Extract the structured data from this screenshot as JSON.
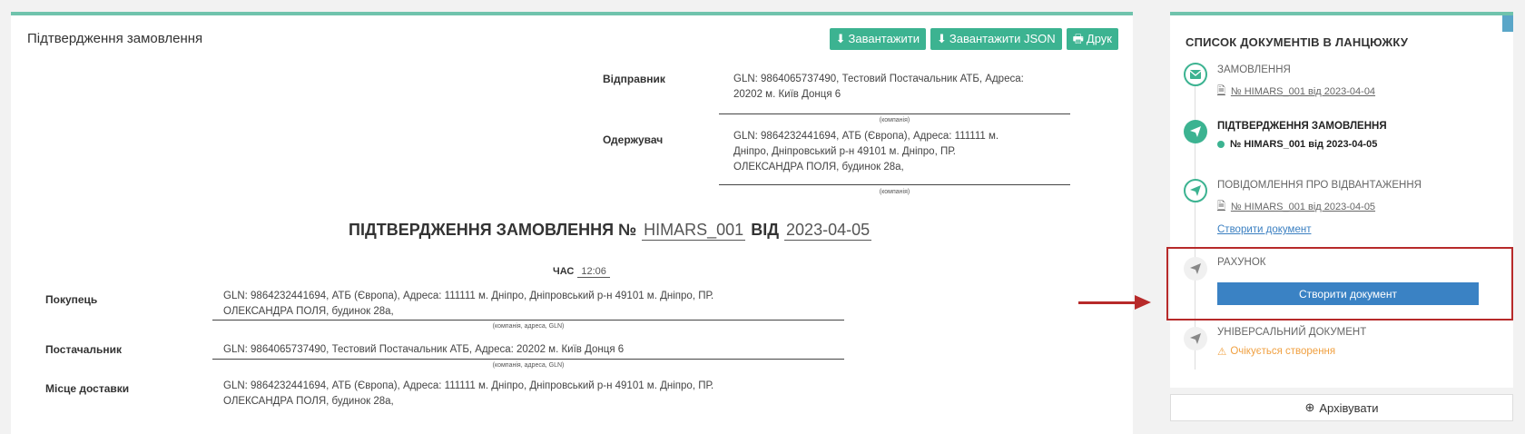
{
  "main": {
    "title": "Підтвердження замовлення",
    "buttons": {
      "download": "Завантажити",
      "download_json": "Завантажити JSON",
      "print": "Друк"
    },
    "sender_label": "Відправник",
    "sender_value": "GLN: 9864065737490, Тестовий Постачальник АТБ, Адреса: 20202 м. Київ Донця 6",
    "company_caption": "(компанія)",
    "receiver_label": "Одержувач",
    "receiver_value": "GLN: 9864232441694, АТБ (Європа), Адреса: 111111 м. Дніпро, Дніпровський р-н 49101 м. Дніпро, ПР. ОЛЕКСАНДРА ПОЛЯ, будинок 28а,",
    "doc_title_prefix": "ПІДТВЕРДЖЕННЯ ЗАМОВЛЕННЯ №",
    "doc_number": "HIMARS_001",
    "doc_from": "ВІД",
    "doc_date": "2023-04-05",
    "time_label": "ЧАС",
    "time_value": "12:06",
    "buyer_label": "Покупець",
    "buyer_value": "GLN: 9864232441694, АТБ (Європа), Адреса: 111111 м. Дніпро, Дніпровський р-н 49101 м. Дніпро, ПР. ОЛЕКСАНДРА ПОЛЯ, будинок 28а,",
    "party_caption": "(компанія, адреса, GLN)",
    "supplier_label": "Постачальник",
    "supplier_value": "GLN: 9864065737490, Тестовий Постачальник АТБ, Адреса: 20202 м. Київ Донця 6",
    "delivery_label": "Місце доставки",
    "delivery_value": "GLN: 9864232441694, АТБ (Європа), Адреса: 111111 м. Дніпро, Дніпровський р-н 49101 м. Дніпро, ПР. ОЛЕКСАНДРА ПОЛЯ, будинок 28а,"
  },
  "sidebar": {
    "title": "СПИСОК ДОКУМЕНТІВ В ЛАНЦЮЖКУ",
    "steps": [
      {
        "title": "ЗАМОВЛЕННЯ",
        "link": "№ HIMARS_001 від 2023-04-04",
        "icon": "envelope-icon"
      },
      {
        "title": "ПІДТВЕРДЖЕННЯ ЗАМОВЛЕННЯ",
        "link": "№ HIMARS_001 від 2023-04-05",
        "icon": "paper-plane-icon"
      },
      {
        "title": "ПОВІДОМЛЕННЯ ПРО ВІДВАНТАЖЕННЯ",
        "link": "№ HIMARS_001 від 2023-04-05",
        "create": "Створити документ",
        "icon": "paper-plane-icon"
      },
      {
        "title": "РАХУНОК",
        "button": "Створити документ",
        "icon": "paper-plane-icon"
      },
      {
        "title": "УНІВЕРСАЛЬНИЙ ДОКУМЕНТ",
        "status": "Очікується створення",
        "icon": "paper-plane-icon"
      }
    ],
    "archive_label": "Архівувати"
  },
  "colors": {
    "accent": "#3cb391",
    "primary": "#3a82c4",
    "warning": "#f0a040",
    "annotation": "#b72a2a"
  }
}
